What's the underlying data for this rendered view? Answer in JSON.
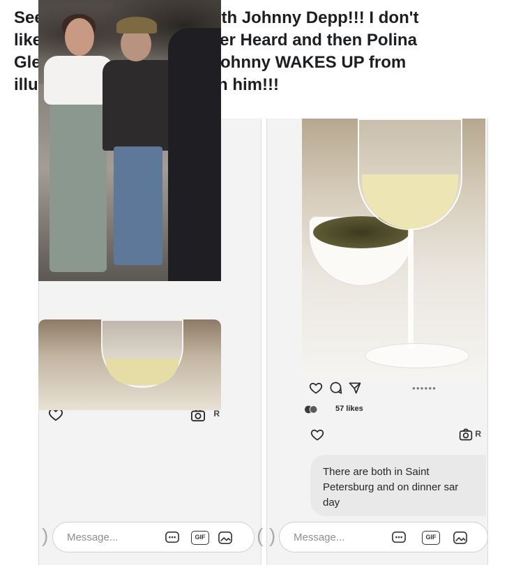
{
  "post": {
    "text_line1": "See here is Polina Glen with Johnny Depp!!! I don't",
    "text_line2": "like this at all.... First Amber Heard and then Polina",
    "text_line3": "Glen!?!? I just hope that Johnny WAKES UP from",
    "text_line4": "illusions that Polina put on him!!!"
  },
  "left_screenshot": {
    "photo_icon_cut": "R",
    "message_placeholder": "Message...",
    "gif_label": "GIF",
    "icons": [
      "heart-icon",
      "camera-icon",
      "emoji-icon",
      "gif-icon",
      "image-icon"
    ]
  },
  "right_screenshot": {
    "likes": "57 likes",
    "photo_icon_cut": "R",
    "message_line1": "There are both in Saint",
    "message_line2": "Petersburg and on dinner sar",
    "message_line3": "day",
    "message_placeholder": "Message...",
    "gif_label": "GIF",
    "icons": [
      "heart-icon",
      "comment-icon",
      "share-icon",
      "camera-icon",
      "emoji-icon",
      "gif-icon",
      "image-icon"
    ]
  }
}
